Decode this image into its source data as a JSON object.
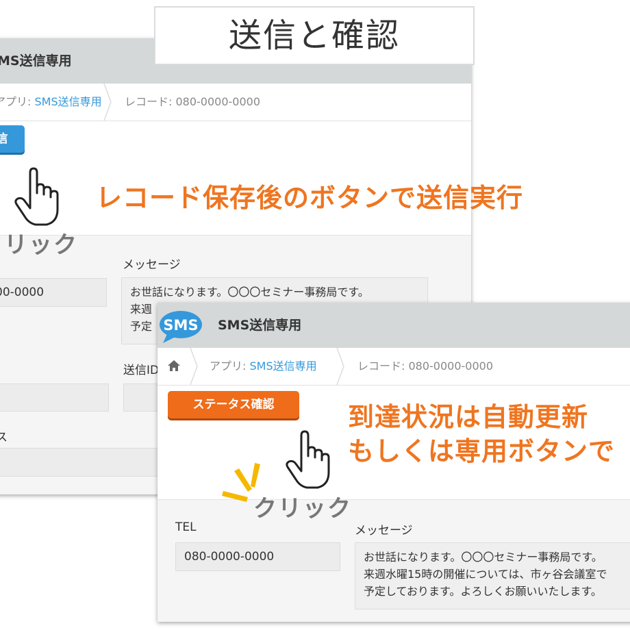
{
  "heading": "送信と確認",
  "window1": {
    "title": "MS送信専用",
    "breadcrumb": {
      "app_prefix": "アプリ: ",
      "app_link": "SMS送信専用",
      "record": "レコード: 080-0000-0000"
    },
    "send_button": "信",
    "instruction": "レコード保存後のボタンで送信実行",
    "click_label": "クリック",
    "fields": {
      "tel_value": "00-0000",
      "message_label": "メッセージ",
      "message_lines": [
        "お世話になります。〇〇〇セミナー事務局です。",
        "来週",
        "予定"
      ],
      "sendid_label": "送信ID",
      "status_label": "ス"
    }
  },
  "window2": {
    "logo_text": "SMS",
    "title": "SMS送信専用",
    "breadcrumb": {
      "app_prefix": "アプリ: ",
      "app_link": "SMS送信専用",
      "record": "レコード: 080-0000-0000"
    },
    "status_button": "ステータス確認",
    "instruction_lines": [
      "到達状況は自動更新",
      "もしくは専用ボタンで"
    ],
    "click_label": "クリック",
    "fields": {
      "tel_label": "TEL",
      "tel_value": "080-0000-0000",
      "message_label": "メッセージ",
      "message_lines": [
        "お世話になります。〇〇〇セミナー事務局です。",
        "来週水曜15時の開催については、市ヶ谷会議室で",
        "予定しております。よろしくお願いいたします。"
      ]
    }
  },
  "colors": {
    "accent_blue": "#3498db",
    "accent_orange": "#ef6c1a",
    "instruction_orange": "#ef7520"
  }
}
